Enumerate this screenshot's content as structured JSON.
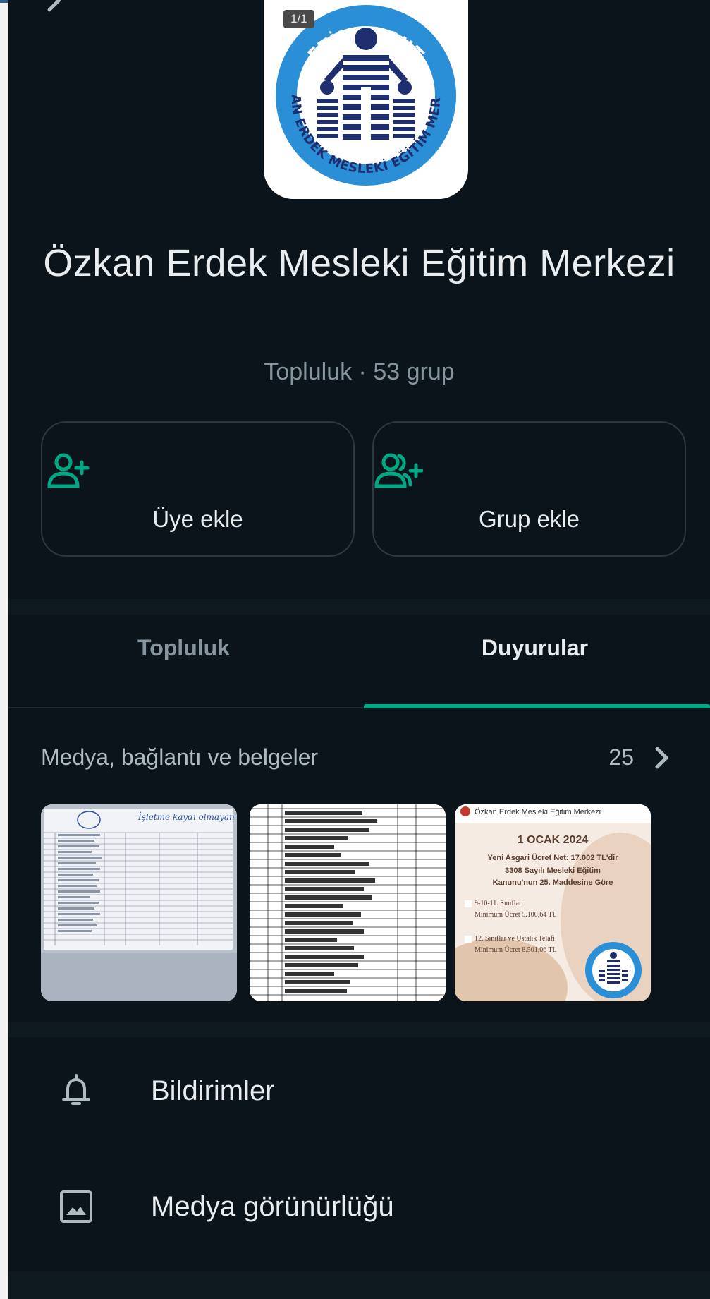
{
  "header": {
    "image_counter": "1/1",
    "logo": {
      "top_text": "ETİMESGUT",
      "ring_text": "ÖZKAN ERDEK MESLEKİ EĞİTİM MERKEZİ"
    }
  },
  "community": {
    "title": "Özkan Erdek Mesleki Eğitim Merkezi",
    "subtitle": "Topluluk · 53 grup"
  },
  "actions": [
    {
      "label": "Üye ekle",
      "icon": "add-person-icon"
    },
    {
      "label": "Grup ekle",
      "icon": "add-group-icon"
    }
  ],
  "tabs": [
    {
      "label": "Topluluk",
      "active": false
    },
    {
      "label": "Duyurular",
      "active": true
    }
  ],
  "media": {
    "header": "Medya, bağlantı ve belgeler",
    "count": "25",
    "thumbnails": [
      {
        "kind": "handwritten-list-photo",
        "handwriting": "İşletme kaydı olmayan öğrenciler"
      },
      {
        "kind": "student-table-scan"
      },
      {
        "kind": "wage-announcement",
        "header": "Özkan Erdek Mesleki Eğitim Merkezi",
        "date": "1 OCAK 2024",
        "line1": "Yeni Asgari Ücret Net: 17.002 TL'dir",
        "line2": "3308 Sayılı Mesleki Eğitim",
        "line3": "Kanunu'nun 25. Maddesine Göre",
        "item1": "9-10-11. Sınıflar",
        "item1_value": "Minimum Ücret 5.100,64 TL",
        "item2": "12. Sınıflar ve Ustalık Telafi",
        "item2_value": "Minimum Ücret 8.501,06 TL"
      }
    ]
  },
  "settings": [
    {
      "label": "Bildirimler",
      "icon": "bell-icon"
    },
    {
      "label": "Medya görünürlüğü",
      "icon": "image-icon"
    }
  ],
  "colors": {
    "background": "#0b141a",
    "accent": "#00a884",
    "text_primary": "#e9edef",
    "text_secondary": "#8696a0",
    "logo_blue": "#2a8fd6",
    "logo_navy": "#1e2e6e"
  }
}
